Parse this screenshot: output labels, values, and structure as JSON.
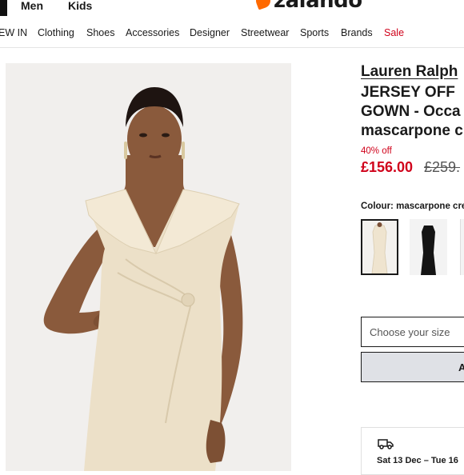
{
  "header": {
    "gender_tabs": [
      "Men",
      "Kids"
    ],
    "logo_text": "zalando",
    "brand_color": "#ff6900"
  },
  "nav": {
    "items": [
      "EW IN",
      "Clothing",
      "Shoes",
      "Accessories",
      "Designer",
      "Streetwear",
      "Sports",
      "Brands",
      "Sale"
    ],
    "sale_color": "#d0021b"
  },
  "product": {
    "brand": "Lauren Ralph",
    "title_lines": [
      "JERSEY OFF",
      "GOWN - Occa",
      "mascarpone c"
    ],
    "discount": "40% off",
    "price": "£156.00",
    "old_price": "£259.",
    "colour_label": "Colour:",
    "colour_value": "mascarpone cre",
    "size_placeholder": "Choose your size",
    "add_button_label": "A",
    "delivery_text": "Sat 13 Dec – Tue 16"
  }
}
